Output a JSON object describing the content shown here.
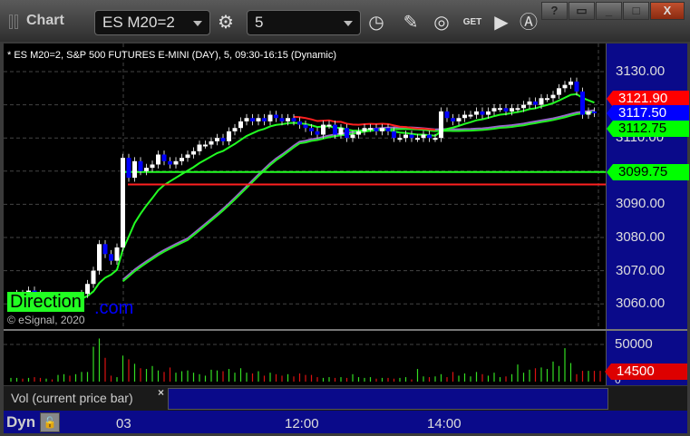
{
  "window": {
    "title": "Chart",
    "symbol": "ES M20=2",
    "interval": "5",
    "buttons": {
      "help": "?",
      "restore_down": "▭",
      "minimize": "_",
      "maximize": "□",
      "close": "X"
    }
  },
  "toolbar": {
    "get_label": "GET",
    "icons": [
      "settings-icon",
      "clock-icon",
      "pencil-icon",
      "study-icon",
      "get-icon",
      "play-icon",
      "alert-icon"
    ]
  },
  "chart_header": "* ES M20=2, S&P 500 FUTURES E-MINI (DAY), 5, 09:30-16:15 (Dynamic)",
  "watermark": {
    "logo": "Direction",
    "suffix": ".com",
    "copyright": "© eSignal, 2020"
  },
  "colors": {
    "up": "#ffffff",
    "down": "#0000ff",
    "vol_up": "#33dd22",
    "vol_down": "#dd1111",
    "axis_bg": "#0a0a8a"
  },
  "price_axis": {
    "ticks": [
      "3130.00",
      "3110.00",
      "3090.00",
      "3080.00",
      "3070.00",
      "3060.00"
    ],
    "tick_values": [
      3130,
      3110,
      3090,
      3080,
      3070,
      3060
    ],
    "flags": [
      {
        "label": "3121.90",
        "value": 3121.9,
        "bg": "#ff0000",
        "fg": "#ffffff"
      },
      {
        "label": "3117.50",
        "value": 3117.5,
        "bg": "#0000ff",
        "fg": "#ffffff"
      },
      {
        "label": "3112.75",
        "value": 3112.75,
        "bg": "#00ff00",
        "fg": "#000000"
      },
      {
        "label": "3099.75",
        "value": 3099.75,
        "bg": "#00ff00",
        "fg": "#000000"
      }
    ]
  },
  "levels": {
    "green": 3099.75,
    "red": 3096
  },
  "volume_pane": {
    "label": "Vol (current price bar)",
    "close": "×",
    "ticks": [
      "50000",
      "0"
    ],
    "flag": "14500"
  },
  "time_axis": {
    "mode": "Dyn",
    "labels": [
      "03",
      "12:00",
      "14:00"
    ]
  },
  "chart_data": {
    "type": "candlestick",
    "ylim": [
      3053,
      3134
    ],
    "closes": [
      3061,
      3063,
      3062,
      3064,
      3063,
      3061,
      3062,
      3060,
      3061,
      3062,
      3060,
      3061,
      3063,
      3066,
      3070,
      3078,
      3075,
      3073,
      3077,
      3104,
      3098,
      3103,
      3100,
      3101,
      3102,
      3105,
      3103,
      3102,
      3103,
      3104,
      3105,
      3106,
      3108,
      3108,
      3109,
      3110,
      3109,
      3112,
      3113,
      3115,
      3116,
      3115,
      3116,
      3115,
      3117,
      3116,
      3115,
      3116,
      3115,
      3114,
      3113,
      3112,
      3111,
      3114,
      3114,
      3111,
      3113,
      3110,
      3111,
      3112,
      3113,
      3113,
      3112,
      3113,
      3112,
      3110,
      3110,
      3111,
      3110,
      3110,
      3111,
      3110,
      3110,
      3118,
      3116,
      3115,
      3116,
      3117,
      3117,
      3118,
      3117,
      3118,
      3119,
      3119,
      3118,
      3119,
      3119,
      3120,
      3121,
      3120,
      3122,
      3122,
      3123,
      3125,
      3126,
      3127,
      3124,
      3117,
      3118,
      3117.5
    ],
    "volume": [
      5000,
      5000,
      4000,
      5000,
      6000,
      5000,
      4000,
      3000,
      9000,
      10000,
      8000,
      10000,
      13000,
      13000,
      47000,
      58000,
      32000,
      8000,
      6000,
      35000,
      30000,
      24000,
      18000,
      17000,
      21000,
      15000,
      13000,
      19000,
      12000,
      14000,
      15000,
      12000,
      10000,
      8000,
      16000,
      15000,
      14000,
      17000,
      12000,
      18000,
      12000,
      11000,
      14000,
      8000,
      12000,
      10000,
      8000,
      10000,
      7000,
      11000,
      9000,
      9000,
      6000,
      5000,
      6000,
      5000,
      6000,
      5000,
      10000,
      6000,
      5000,
      6000,
      4000,
      5000,
      5000,
      4000,
      5000,
      6000,
      3000,
      17000,
      7000,
      6000,
      7000,
      10000,
      6000,
      13000,
      8000,
      11000,
      7000,
      13000,
      10000,
      8000,
      12000,
      6000,
      7000,
      10000,
      23000,
      12000,
      16000,
      18000,
      19000,
      17000,
      27000,
      21000,
      45000,
      25000,
      10000,
      14500,
      14500,
      14500,
      14500
    ]
  }
}
